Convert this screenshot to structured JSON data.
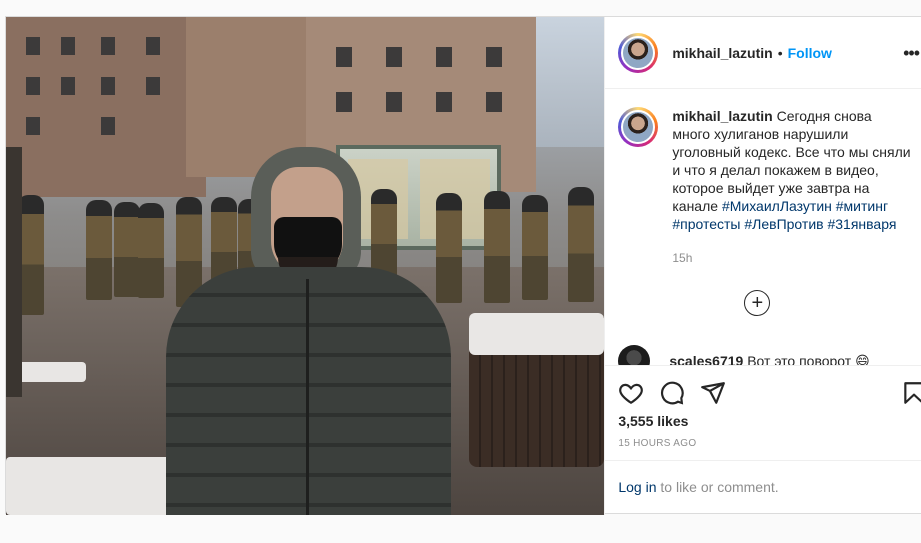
{
  "post": {
    "photo_alt": "",
    "author": {
      "username": "mikhail_lazutin",
      "separator": "•",
      "follow_label": "Follow",
      "more_icon": "more-options-icon"
    },
    "caption": {
      "username": "mikhail_lazutin",
      "text": "Сегодня снова много хулиганов нарушили уголовный кодекс. Все что мы сняли и что я делал покажем в видео, которое выйдет уже завтра на канале",
      "hashtags": "#МихаилЛазутин #митинг #протесты #ЛевПротив #31января",
      "time": "15h"
    },
    "load_more_symbol": "+",
    "comment": {
      "username": "scales6719",
      "text": "Вот это поворот 😄"
    },
    "actions": {
      "like_icon": "heart-icon",
      "comment_icon": "comment-icon",
      "share_icon": "share-icon",
      "save_icon": "bookmark-icon"
    },
    "likes": "3,555 likes",
    "ago": "15 HOURS AGO",
    "login": {
      "link": "Log in",
      "rest": " to like or comment."
    }
  }
}
